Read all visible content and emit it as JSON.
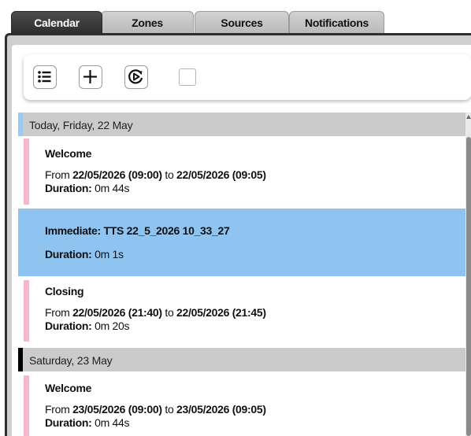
{
  "tabs": [
    {
      "label": "Calendar",
      "active": true
    },
    {
      "label": "Zones",
      "active": false
    },
    {
      "label": "Sources",
      "active": false
    },
    {
      "label": "Notifications",
      "active": false
    }
  ],
  "toolbar": {
    "list_icon": "list-icon",
    "add_icon": "plus-icon",
    "play_icon": "play-cycle-icon",
    "select_all_checked": false
  },
  "colors": {
    "active_tab": "#3a3a3a",
    "today_marker": "#9ccaf2",
    "saturday_marker": "#000000",
    "event_stripe": "#f4b8cc",
    "selected_event": "#90c4f0",
    "day_header_bg": "#cbcbcb"
  },
  "days": [
    {
      "header": "Today, Friday, 22 May",
      "events": [
        {
          "title": "Welcome",
          "from_word": "From",
          "start": "22/05/2026 (09:00)",
          "to_word": "to",
          "end": "22/05/2026 (09:05)",
          "duration_label": "Duration:",
          "duration": "0m 44s"
        },
        {
          "title": "Immediate: TTS 22_5_2026 10_33_27",
          "duration_label": "Duration:",
          "duration": "0m 1s",
          "selected": true
        },
        {
          "title": "Closing",
          "from_word": "From",
          "start": "22/05/2026 (21:40)",
          "to_word": "to",
          "end": "22/05/2026 (21:45)",
          "duration_label": "Duration:",
          "duration": "0m 20s"
        }
      ]
    },
    {
      "header": "Saturday, 23 May",
      "events": [
        {
          "title": "Welcome",
          "from_word": "From",
          "start": "23/05/2026 (09:00)",
          "to_word": "to",
          "end": "23/05/2026 (09:05)",
          "duration_label": "Duration:",
          "duration": "0m 44s"
        }
      ]
    }
  ]
}
